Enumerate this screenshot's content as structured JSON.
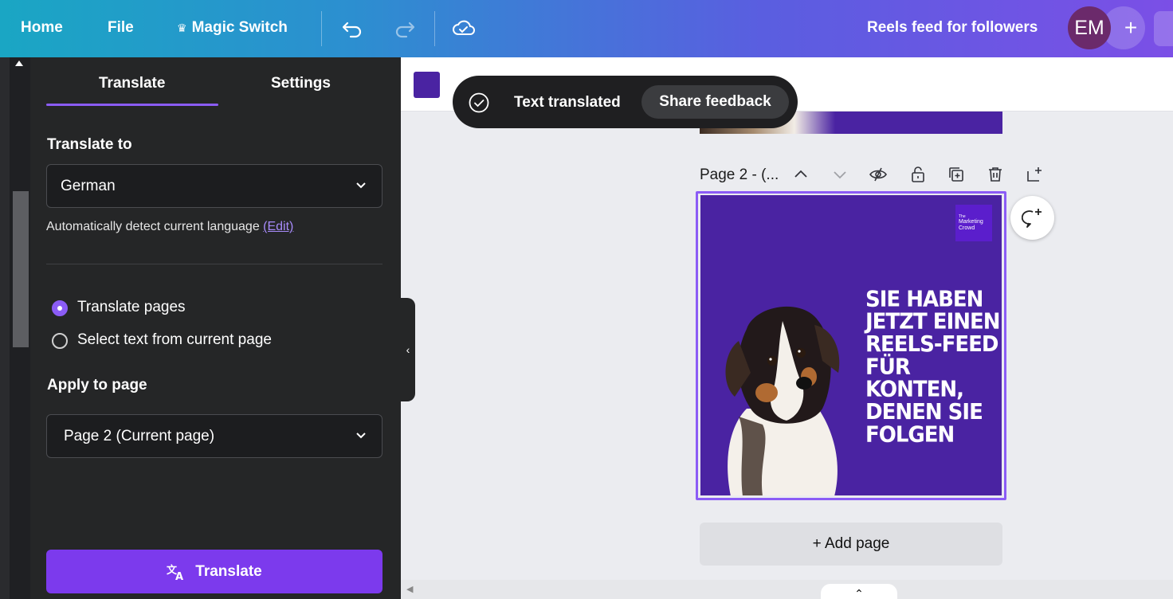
{
  "topbar": {
    "home": "Home",
    "file": "File",
    "magic_switch": "Magic Switch",
    "project_title": "Reels feed for followers",
    "avatar_initials": "EM",
    "add": "+"
  },
  "panel": {
    "tabs": [
      "Translate",
      "Settings"
    ],
    "active_tab": "Translate",
    "translate_to_label": "Translate to",
    "language": "German",
    "hint_text": "Automatically detect current language ",
    "hint_link": "(Edit)",
    "radio_options": [
      {
        "label": "Translate pages",
        "selected": true
      },
      {
        "label": "Select text from current page",
        "selected": false
      }
    ],
    "apply_label": "Apply to page",
    "page_select": "Page 2 (Current page)",
    "translate_button": "Translate"
  },
  "toast": {
    "message": "Text translated",
    "feedback_button": "Share feedback"
  },
  "canvas": {
    "page_title": "Page 2 - (...",
    "logo_text": [
      "The",
      "Marketing",
      "Crowd"
    ],
    "headline_lines": [
      "SIE HABEN",
      "JETZT EINEN",
      "REELS-FEED",
      "FÜR KONTEN,",
      "DENEN SIE",
      "FOLGEN"
    ],
    "add_page": "+ Add page",
    "accent_color": "#8b5cf6",
    "page_color": "#4a23a2"
  }
}
